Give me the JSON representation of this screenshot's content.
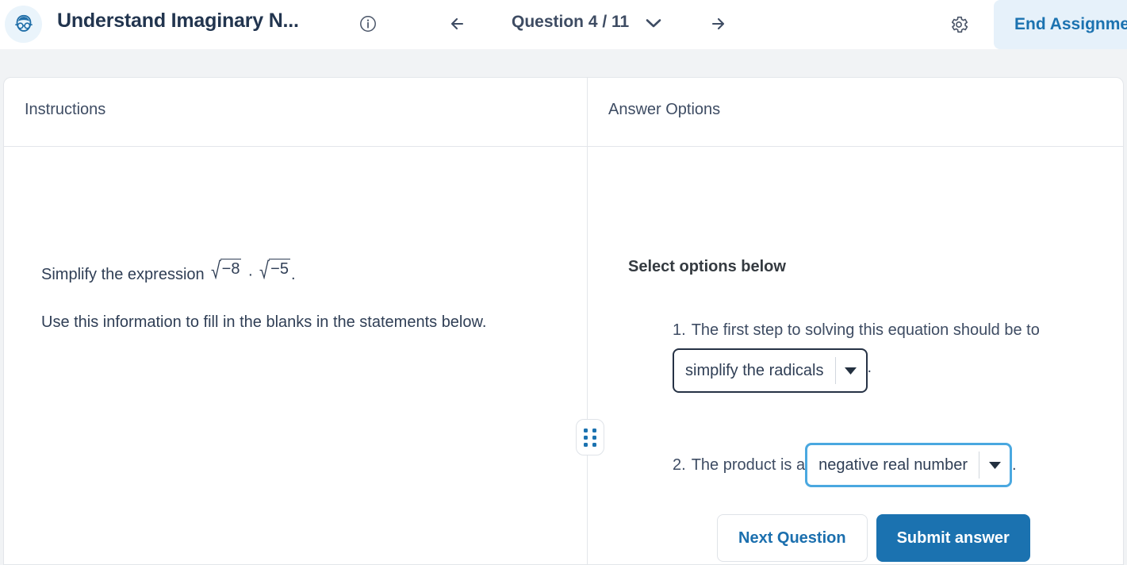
{
  "header": {
    "avatar_icon": "person-with-glasses-avatar-icon",
    "title": "Understand Imaginary N...",
    "info_icon": "info-circle-icon",
    "back_icon": "arrow-left-icon",
    "forward_icon": "arrow-right-icon",
    "question_counter": "Question 4 / 11",
    "question_chevron_icon": "chevron-down-icon",
    "gear_icon": "gear-icon",
    "end_assignment_label": "End Assignment",
    "end_assignment_bg": "#e6f1fa",
    "end_assignment_color": "#1b72b0"
  },
  "panels": {
    "left_header": "Instructions",
    "right_header": "Answer Options"
  },
  "instructions": {
    "line1_prefix": "Simplify the expression",
    "radical_1": "−8",
    "operator": "·",
    "radical_2": "−5",
    "line1_suffix": ".",
    "line2": "Use this information to fill in the blanks in the statements below."
  },
  "divider": {
    "drag_handle_icon": "drag-dots-handle-icon",
    "dot_color": "#1b72b0"
  },
  "answers": {
    "select_label": "Select options below",
    "statements": [
      {
        "number": "1.",
        "text_before": "The first step to solving this equation should be to",
        "dropdown_value": "simplify the radicals",
        "caret_icon": "caret-down-icon",
        "text_after": ".",
        "state": "plain",
        "border_color": "#263245"
      },
      {
        "number": "2.",
        "text_before": "The product is a",
        "dropdown_value": "negative real number",
        "caret_icon": "caret-down-icon",
        "text_after": ".",
        "state": "focused",
        "border_color": "#4aa8e0"
      }
    ],
    "next_button_label": "Next Question",
    "submit_button_label": "Submit answer",
    "submit_button_bg": "#1b72b0"
  }
}
